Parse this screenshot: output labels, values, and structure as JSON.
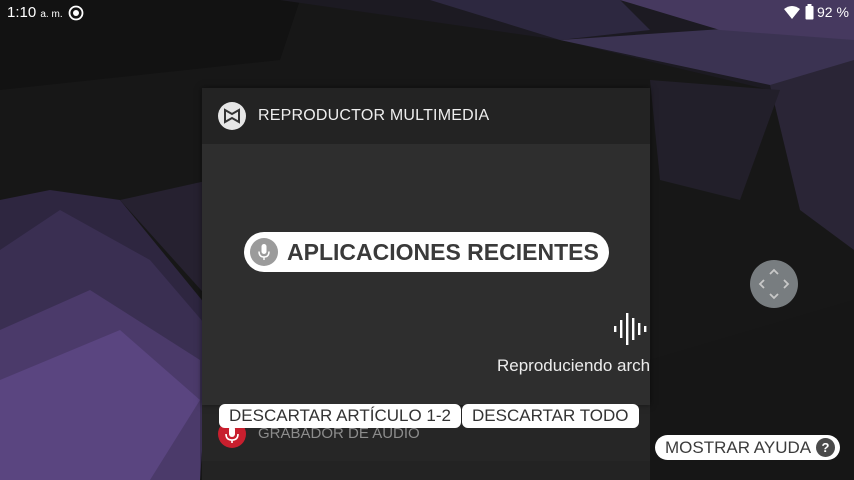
{
  "status_bar": {
    "time": "1:10",
    "ampm": "a. m.",
    "battery_percent": "92 %",
    "icons": [
      "sync-icon",
      "wifi-icon",
      "battery-icon"
    ]
  },
  "recents": {
    "current_card": {
      "app_title": "REPRODUCTOR MULTIMEDIA",
      "playing_text": "Reproduciendo arch",
      "icons": [
        "media-player-icon",
        "sound-wave-icon"
      ]
    },
    "next_card": {
      "app_title": "GRABADOR DE AUDIO",
      "icon": "recorder-mic-icon",
      "accent": "#c81f2e"
    }
  },
  "voice_access": {
    "title_label": "APLICACIONES RECIENTES",
    "dismiss_item_label": "DESCARTAR ARTÍCULO 1-2",
    "dismiss_all_label": "DESCARTAR TODO",
    "help_label": "MOSTRAR AYUDA",
    "help_icon_glyph": "?"
  },
  "colors": {
    "card_bg": "#2e2e2e",
    "card_header_bg": "#232323",
    "label_bg": "#ffffff"
  }
}
